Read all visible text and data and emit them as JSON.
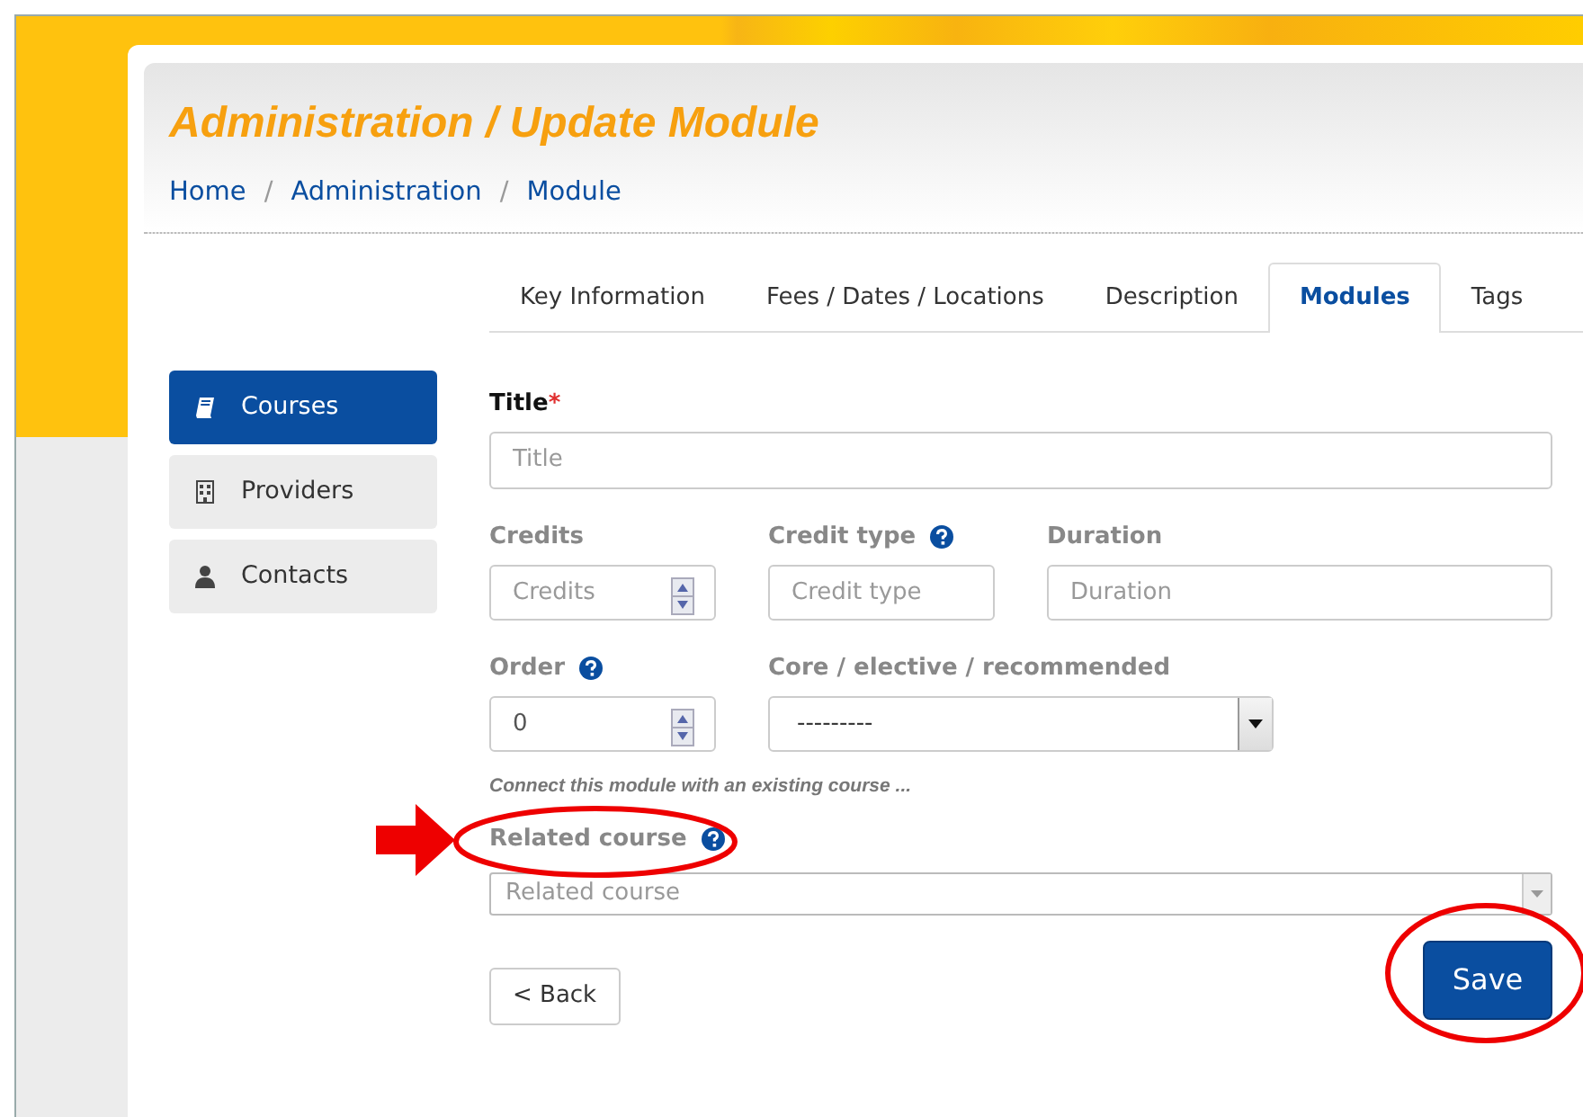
{
  "header": {
    "title": "Administration / Update Module",
    "separator": "/",
    "breadcrumb": [
      {
        "label": "Home"
      },
      {
        "label": "Administration"
      },
      {
        "label": "Module"
      }
    ]
  },
  "tabs": [
    {
      "label": "Key Information",
      "selected": false
    },
    {
      "label": "Fees / Dates / Locations",
      "selected": false
    },
    {
      "label": "Description",
      "selected": false
    },
    {
      "label": "Modules",
      "selected": true
    },
    {
      "label": "Tags",
      "selected": false
    }
  ],
  "sidebar": {
    "items": [
      {
        "label": "Courses",
        "kind": "book",
        "selected": true
      },
      {
        "label": "Providers",
        "kind": "building",
        "selected": false
      },
      {
        "label": "Contacts",
        "kind": "person",
        "selected": false
      }
    ]
  },
  "form": {
    "title": {
      "label": "Title",
      "required": true,
      "required_mark": "*",
      "placeholder": "Title"
    },
    "row_1": [
      {
        "label": "Credits",
        "kind": "number",
        "help": false,
        "placeholder": "Credits"
      },
      {
        "label": "Credit type",
        "kind": "text",
        "help": true,
        "placeholder": "Credit type"
      },
      {
        "label": "Duration",
        "kind": "text",
        "help": false,
        "placeholder": "Duration"
      }
    ],
    "row_2": [
      {
        "label": "Order",
        "kind": "number",
        "help": true,
        "value": "0"
      },
      {
        "label": "Core / elective / recommended",
        "kind": "select",
        "help": false,
        "value": "---------"
      }
    ],
    "hint": "Connect this module with an existing course ...",
    "related": {
      "label": "Related course",
      "help": true,
      "placeholder": "Related course"
    }
  },
  "buttons": [
    {
      "label": "< Back",
      "kind": "secondary"
    },
    {
      "label": "Save",
      "kind": "primary"
    }
  ],
  "annotations": [
    {
      "kind": "arrow"
    },
    {
      "kind": "ellipse"
    },
    {
      "kind": "ellipse"
    }
  ]
}
